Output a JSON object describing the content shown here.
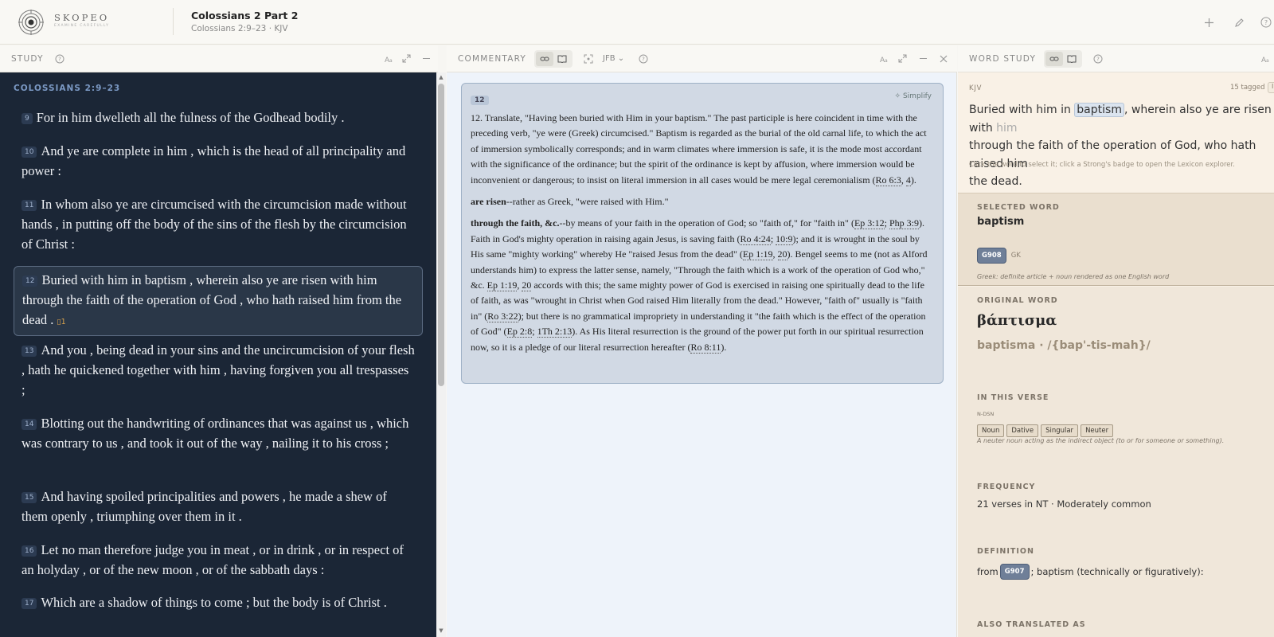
{
  "header": {
    "logo_text": "SKOPEO",
    "logo_tagline": "EXAMINE CAREFULLY",
    "title": "Colossians 2 Part 2",
    "subtitle": "Colossians 2:9–23 · KJV",
    "icons": [
      "plus-icon",
      "pencil-icon",
      "help-icon"
    ]
  },
  "study": {
    "label": "STUDY",
    "reference": "COLOSSIANS 2:9–23",
    "verses": [
      {
        "num": "9",
        "text": "For in him dwelleth all the fulness of the Godhead bodily ."
      },
      {
        "num": "10",
        "text": "And ye are complete in him , which is the head of all principality and power :"
      },
      {
        "num": "11",
        "text": "In whom also ye are circumcised with the circumcision made without hands , in putting off the body of the sins of the flesh by the circumcision of Christ :"
      },
      {
        "num": "12",
        "text": "Buried with him in baptism , wherein also ye are risen with him through the faith of the operation of God , who hath raised him from the dead .",
        "note_count": "1"
      },
      {
        "num": "13",
        "text": "And you , being dead in your sins and the uncircumcision of your flesh , hath he quickened together with him , having forgiven you all trespasses ;"
      },
      {
        "num": "14",
        "text": "Blotting out the handwriting of ordinances that was against us , which was contrary to us , and took it out of the way , nailing it to his cross ;"
      },
      {
        "num": "15",
        "text": "And having spoiled principalities and powers , he made a shew of them openly , triumphing over them in it ."
      },
      {
        "num": "16",
        "text": "Let no man therefore judge you in meat , or in drink , or in respect of an holyday , or of the new moon , or of the sabbath days :"
      },
      {
        "num": "17",
        "text": "Which are a shadow of things to come ; but the body is of Christ ."
      }
    ]
  },
  "commentary": {
    "label": "COMMENTARY",
    "source": "JFB",
    "verse_num": "12",
    "simplify_label": "Simplify",
    "p1": {
      "a": "12. Translate, \"Having been buried with Him in your baptism.\" The past participle is here coincident in time with the preceding verb, \"ye were (Greek) circumcised.\" Baptism is regarded as the burial of the old carnal life, to which the act of immersion symbolically corresponds; and in warm climates where immersion is safe, it is the mode most accordant with the significance of the ordinance; but the spirit of the ordinance is kept by affusion, where immersion would be inconvenient or dangerous; to insist on literal immersion in all cases would be mere legal ceremonialism (",
      "r1": "Ro 6:3",
      "sep": ", ",
      "r2": "4",
      "end": ")."
    },
    "p2": {
      "bold": "are risen",
      "rest": "--rather as Greek, \"were raised with Him.\""
    },
    "p3": {
      "bold": "through the faith, &c.",
      "t1": "--by means of your faith in the operation of God; so \"faith of,\" for \"faith in\" (",
      "r1": "Ep 3:12",
      "t2": "; ",
      "r2": "Php 3:9",
      "t3": "). Faith in God's mighty operation in raising again Jesus, is saving faith (",
      "r3": "Ro 4:24",
      "t4": "; ",
      "r4": "10:9",
      "t5": "); and it is wrought in the soul by His same \"mighty working\" whereby He \"raised Jesus from the dead\" (",
      "r5": "Ep 1:19",
      "t6": ", ",
      "r6": "20",
      "t7": "). Bengel seems to me (not as Alford understands him) to express the latter sense, namely, \"Through the faith which is a work of the operation of God who,\" &c. ",
      "r7": "Ep 1:19",
      "t8": ", ",
      "r8": "20",
      "t9": " accords with this; the same mighty power of God is exercised in raising one spiritually dead to the life of faith, as was \"wrought in Christ when God raised Him literally from the dead.\" However, \"faith of\" usually is \"faith in\" (",
      "r9": "Ro 3:22",
      "t10": "); but there is no grammatical impropriety in understanding it \"the faith which is the effect of the operation of God\" (",
      "r10": "Ep 2:8",
      "t11": "; ",
      "r11": "1Th 2:13",
      "t12": "). As His literal resurrection is the ground of the power put forth in our spiritual resurrection now, so it is a pledge of our literal resurrection hereafter (",
      "r12": "Ro 8:11",
      "t13": ")."
    }
  },
  "word_study": {
    "label": "WORD STUDY",
    "version": "KJV",
    "tagged": "15 tagged",
    "verse_before": "Buried with him in ",
    "verse_word": "baptism",
    "verse_after": ", wherein also ye are risen with ",
    "verse_dim": "him",
    "verse_line2": "through the faith of the operation of God, who hath raised him",
    "verse_line3": "the dead.",
    "hint": "Click the word to select it; click a Strong's badge to open the Lexicon explorer.",
    "selected_label": "SELECTED WORD",
    "selected_word": "baptism",
    "strongs": "G908",
    "lang": "GK",
    "greek_note": "Greek: definite article + noun rendered as one English word",
    "original_label": "ORIGINAL WORD",
    "greek": "βάπτισμα",
    "translit": "baptisma · /{bap'-tis-mah}/",
    "in_verse_label": "IN THIS VERSE",
    "parse_code": "N-DSN",
    "tags": [
      "Noun",
      "Dative",
      "Singular",
      "Neuter"
    ],
    "usage_note": "A neuter noun acting as the indirect object (to or for someone or something).",
    "frequency_label": "FREQUENCY",
    "frequency": "21 verses in NT · Moderately common",
    "definition_label": "DEFINITION",
    "def_from": "from ",
    "def_strongs": "G907",
    "def_rest": "; baptism (technically or figuratively):",
    "also_label": "ALSO TRANSLATED AS"
  }
}
